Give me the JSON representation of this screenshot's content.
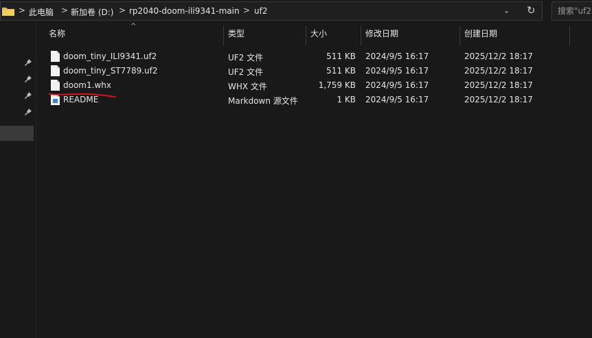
{
  "address": {
    "crumbs": [
      "此电脑",
      "新加卷 (D:)",
      "rp2040-doom-ili9341-main",
      "uf2"
    ],
    "separator": ">",
    "dropdown_glyph": "⌄",
    "refresh_glyph": "↻"
  },
  "search": {
    "placeholder": "搜索\"uf2\""
  },
  "columns": [
    "名称",
    "类型",
    "大小",
    "修改日期",
    "创建日期"
  ],
  "files": [
    {
      "name": "doom_tiny_ILI9341.uf2",
      "type": "UF2 文件",
      "size": "511 KB",
      "modified": "2024/9/5 16:17",
      "created": "2025/12/2 18:17",
      "icon": "file-icon"
    },
    {
      "name": "doom_tiny_ST7789.uf2",
      "type": "UF2 文件",
      "size": "511 KB",
      "modified": "2024/9/5 16:17",
      "created": "2025/12/2 18:17",
      "icon": "file-icon"
    },
    {
      "name": "doom1.whx",
      "type": "WHX 文件",
      "size": "1,759 KB",
      "modified": "2024/9/5 16:17",
      "created": "2025/12/2 18:17",
      "icon": "file-icon"
    },
    {
      "name": "README",
      "type": "Markdown 源文件",
      "size": "1 KB",
      "modified": "2024/9/5 16:17",
      "created": "2025/12/2 18:17",
      "icon": "markdown-file-icon"
    }
  ],
  "annotation": {
    "color": "#d9141b",
    "highlighted_file": "doom1.whx"
  }
}
